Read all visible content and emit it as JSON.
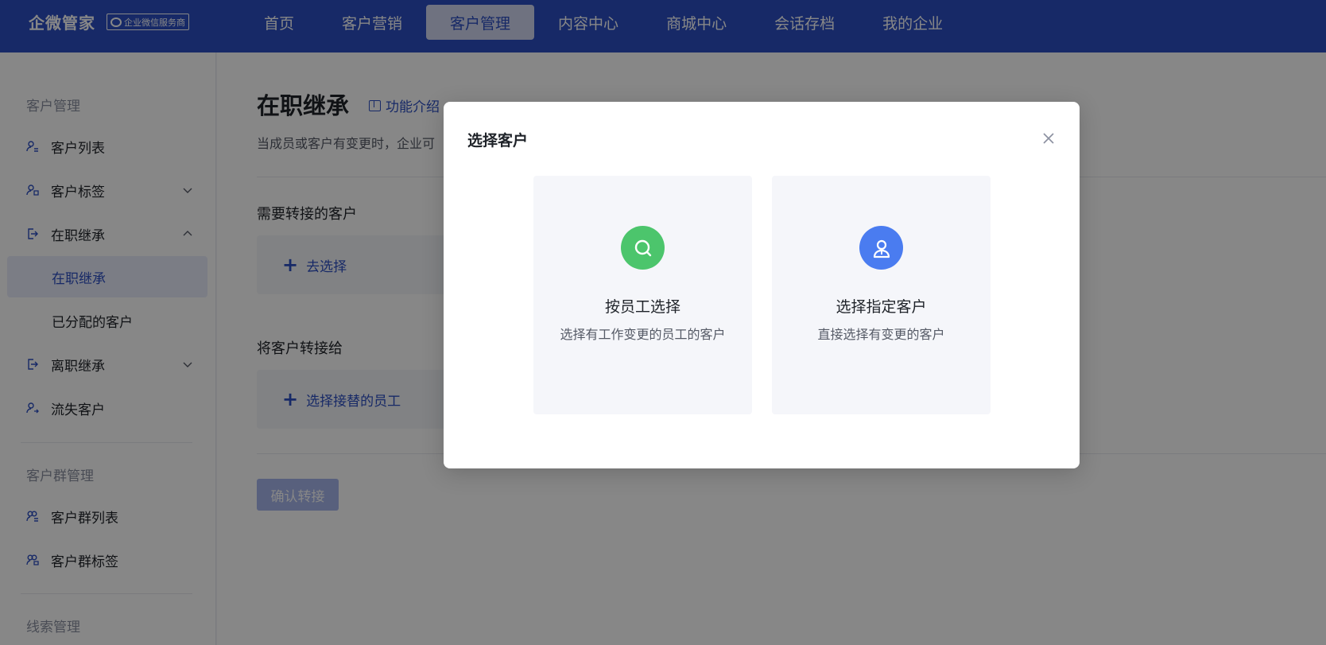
{
  "brand": {
    "name": "企微管家",
    "tag": "企业微信服务商"
  },
  "nav": {
    "items": [
      {
        "label": "首页",
        "active": false
      },
      {
        "label": "客户营销",
        "active": false
      },
      {
        "label": "客户管理",
        "active": true
      },
      {
        "label": "内容中心",
        "active": false
      },
      {
        "label": "商城中心",
        "active": false
      },
      {
        "label": "会话存档",
        "active": false
      },
      {
        "label": "我的企业",
        "active": false
      }
    ]
  },
  "sidebar": {
    "group1": "客户管理",
    "customer_list": "客户列表",
    "customer_tags": "客户标签",
    "inherit_on_job": "在职继承",
    "sub_inherit_on_job": "在职继承",
    "sub_assigned": "已分配的客户",
    "inherit_resigned": "离职继承",
    "lost_customers": "流失客户",
    "group2": "客户群管理",
    "group_list": "客户群列表",
    "group_tags": "客户群标签",
    "group3": "线索管理"
  },
  "main": {
    "title": "在职继承",
    "func_intro": "功能介绍",
    "description": "当成员或客户有变更时，企业可",
    "need_transfer_label": "需要转接的客户",
    "go_select": "去选择",
    "transfer_to_label": "将客户转接给",
    "select_successor": "选择接替的员工",
    "confirm_button": "确认转接"
  },
  "modal": {
    "title": "选择客户",
    "option1": {
      "title": "按员工选择",
      "desc": "选择有工作变更的员工的客户",
      "icon": "search-icon",
      "color": "#4cc56c"
    },
    "option2": {
      "title": "选择指定客户",
      "desc": "直接选择有变更的客户",
      "icon": "user-icon",
      "color": "#4a7cf0"
    }
  },
  "colors": {
    "primary": "#2d4fc2",
    "overlay": "rgba(0,0,0,0.47)"
  }
}
